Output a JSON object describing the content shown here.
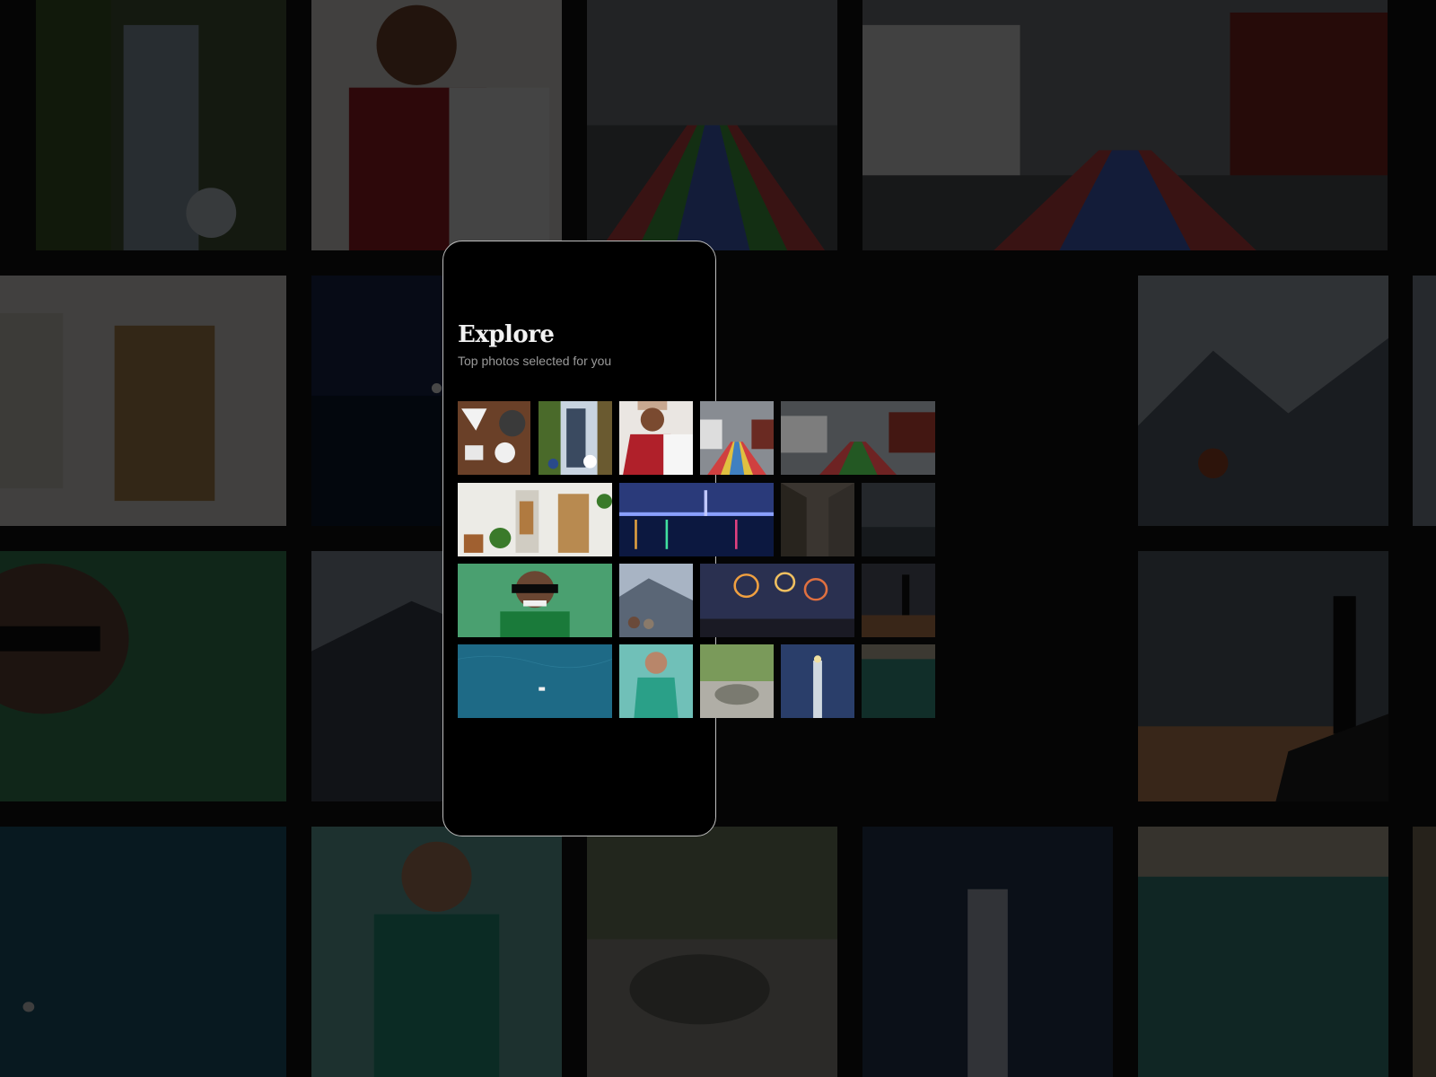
{
  "explore": {
    "title": "Explore",
    "subtitle": "Top photos selected for you"
  },
  "colors": {
    "background": "#050505",
    "phone_background": "#000000",
    "phone_border": "#bdbdbd",
    "title": "#f2f2f2",
    "subtitle": "#9a9a9a"
  },
  "photos": [
    {
      "name": "coffee-photo",
      "subject": "coffee"
    },
    {
      "name": "tower-photo",
      "subject": "tower"
    },
    {
      "name": "woman-jacket-photo",
      "subject": "woman in red jacket"
    },
    {
      "name": "rainbow-street-photo",
      "subject": "rainbow street"
    },
    {
      "name": "rainbow-street-wide-photo",
      "subject": "rainbow street"
    },
    {
      "name": "interior-photo",
      "subject": "interior"
    },
    {
      "name": "night-city-photo",
      "subject": "city at night"
    },
    {
      "name": "alley-photo",
      "subject": "alley"
    },
    {
      "name": "misty-photo",
      "subject": "mist"
    },
    {
      "name": "man-sunglasses-photo",
      "subject": "man with sunglasses"
    },
    {
      "name": "mountain-view-photo",
      "subject": "mountain view"
    },
    {
      "name": "fireworks-photo",
      "subject": "fireworks"
    },
    {
      "name": "silhouette-photo",
      "subject": "silhouette"
    },
    {
      "name": "ocean-boat-photo",
      "subject": "boat on ocean"
    },
    {
      "name": "man-green-shirt-photo",
      "subject": "man in green shirt"
    },
    {
      "name": "cat-photo",
      "subject": "cat"
    },
    {
      "name": "lighthouse-photo",
      "subject": "lighthouse"
    },
    {
      "name": "sea-photo",
      "subject": "sea"
    }
  ]
}
